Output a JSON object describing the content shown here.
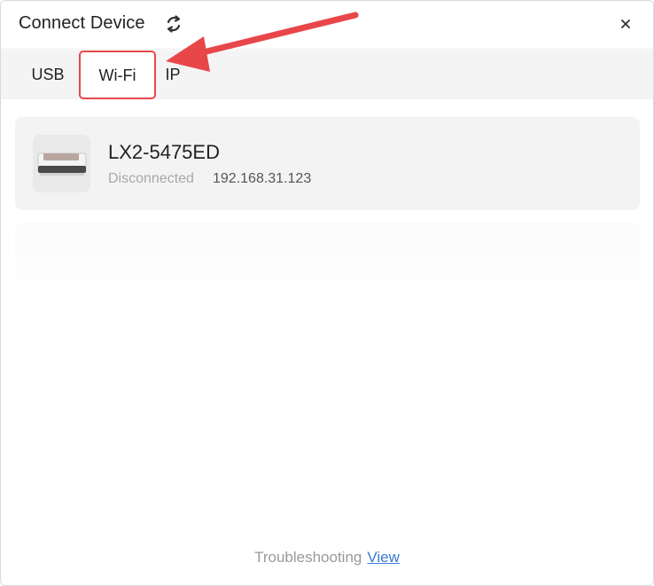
{
  "dialog": {
    "title": "Connect Device",
    "refresh_icon": "refresh-icon",
    "close_label": "×"
  },
  "tabs": [
    {
      "label": "USB",
      "active": false
    },
    {
      "label": "Wi-Fi",
      "active": true
    },
    {
      "label": "IP",
      "active": false
    }
  ],
  "devices": [
    {
      "name": "LX2-5475ED",
      "status": "Disconnected",
      "ip": "192.168.31.123",
      "icon": "laser-engraver-thumbnail"
    }
  ],
  "footer": {
    "text": "Troubleshooting",
    "link": "View"
  },
  "colors": {
    "annotation": "#e8474a",
    "link": "#3a7bd5",
    "tab_bar": "#f4f4f4",
    "card": "#f3f3f3"
  }
}
